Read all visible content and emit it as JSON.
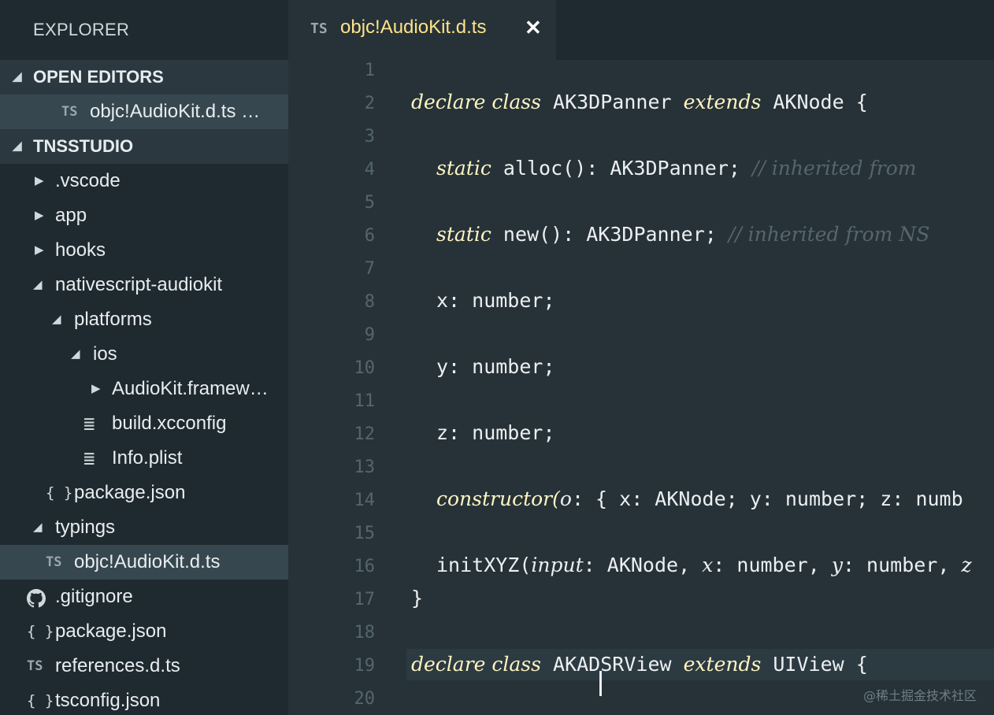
{
  "explorer": {
    "title": "EXPLORER",
    "open_editors": {
      "header": "OPEN EDITORS",
      "items": [
        {
          "icon": "TS",
          "label": "objc!AudioKit.d.ts …"
        }
      ]
    },
    "project": {
      "header": "TNSSTUDIO",
      "tree": [
        {
          "label": ".vscode",
          "icon": "▶"
        },
        {
          "label": "app",
          "icon": "▶"
        },
        {
          "label": "hooks",
          "icon": "▶"
        },
        {
          "label": "nativescript-audiokit",
          "icon": "◢"
        },
        {
          "label": "platforms",
          "icon": "◢"
        },
        {
          "label": "ios",
          "icon": "◢"
        },
        {
          "label": "AudioKit.framew…",
          "icon": "▶"
        },
        {
          "label": "build.xcconfig",
          "icon": "≣"
        },
        {
          "label": "Info.plist",
          "icon": "≣"
        },
        {
          "label": "package.json",
          "icon": "{ }"
        },
        {
          "label": "typings",
          "icon": "◢"
        },
        {
          "label": "objc!AudioKit.d.ts",
          "icon": "TS"
        },
        {
          "label": ".gitignore",
          "icon": "github-icon"
        },
        {
          "label": "package.json",
          "icon": "{ }"
        },
        {
          "label": "references.d.ts",
          "icon": "TS"
        },
        {
          "label": "tsconfig.json",
          "icon": "{ }"
        }
      ]
    }
  },
  "tab": {
    "icon": "TS",
    "label": "objc!AudioKit.d.ts",
    "close": "✕"
  },
  "editor": {
    "line_numbers": [
      "1",
      "2",
      "3",
      "4",
      "5",
      "6",
      "7",
      "8",
      "9",
      "10",
      "11",
      "12",
      "13",
      "14",
      "15",
      "16",
      "17",
      "18",
      "19",
      "20"
    ],
    "lines": {
      "l2": {
        "kw1": "declare class",
        "name": "AK3DPanner",
        "kw2": "extends",
        "base": "AKNode {"
      },
      "l4": {
        "kw": "static",
        "rest": "alloc(): AK3DPanner;",
        "comment": "// inherited from"
      },
      "l6": {
        "kw": "static",
        "rest": "new(): AK3DPanner;",
        "comment": "// inherited from NS"
      },
      "l8": "x: number;",
      "l10": "y: number;",
      "l12": "z: number;",
      "l14": {
        "kw": "constructor(",
        "param": "o",
        "rest": ": { x: AKNode; y: number; z: numb"
      },
      "l16": {
        "a": "initXYZ(",
        "p1": "input",
        "b": ": AKNode, ",
        "p2": "x",
        "c": ": number, ",
        "p3": "y",
        "d": ": number, ",
        "p4": "z"
      },
      "l17": "}",
      "l19": {
        "kw1": "declare class",
        "name_a": "AKAD",
        "name_b": "SRView",
        "kw2": "extends",
        "base": "UIView {"
      }
    }
  },
  "watermark": "@稀土掘金技术社区",
  "colors": {
    "background": "#263238",
    "sidebar": "#1f2a30",
    "keyword": "#fff4c2",
    "tab_label": "#ffe28a",
    "comment": "#56656e"
  }
}
